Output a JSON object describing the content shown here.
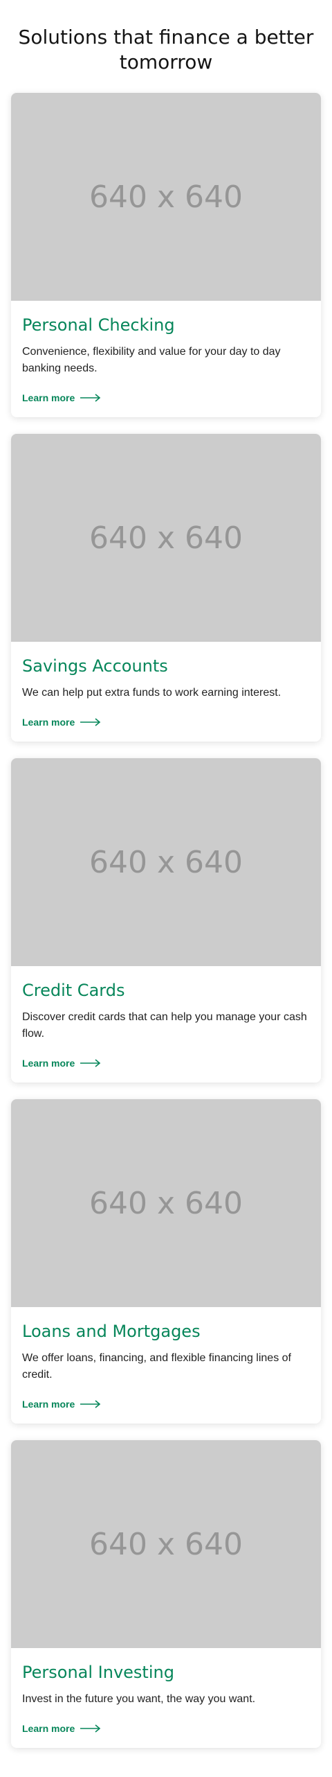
{
  "section": {
    "title": "Solutions that finance a better tomorrow"
  },
  "cards": [
    {
      "image_label": "640 x 640",
      "title": "Personal Checking",
      "description": "Convenience, flexibility and value for your day to day banking needs.",
      "link_label": "Learn more"
    },
    {
      "image_label": "640 x 640",
      "title": "Savings Accounts",
      "description": "We can help put extra funds to work earning interest.",
      "link_label": "Learn more"
    },
    {
      "image_label": "640 x 640",
      "title": "Credit Cards",
      "description": "Discover credit cards that can help you manage your cash flow.",
      "link_label": "Learn more"
    },
    {
      "image_label": "640 x 640",
      "title": "Loans and Mortgages",
      "description": "We offer loans, financing, and flexible financing lines of credit.",
      "link_label": "Learn more"
    },
    {
      "image_label": "640 x 640",
      "title": "Personal Investing",
      "description": "Invest in the future you want, the way you want.",
      "link_label": "Learn more"
    }
  ],
  "icons": {
    "link_arrow": "arrow-right-icon"
  },
  "colors": {
    "accent": "#07865a",
    "placeholder_bg": "#cccccc",
    "placeholder_text": "#969696",
    "heading": "#141414"
  }
}
